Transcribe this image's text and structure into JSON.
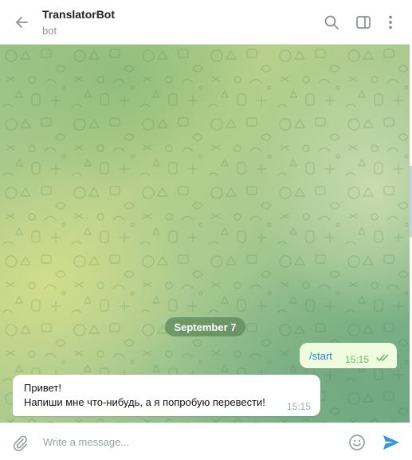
{
  "header": {
    "title": "TranslatorBot",
    "subtitle": "bot",
    "icons": [
      "back-arrow-icon",
      "search-icon",
      "sidebar-toggle-icon",
      "more-vertical-icon"
    ]
  },
  "chat": {
    "date_separator": "September 7",
    "outgoing": {
      "text": "/start",
      "time": "15:15",
      "status": "read"
    },
    "incoming": {
      "line1": "Привет!",
      "line2": "Напиши мне что-нибудь, а я попробую перевести!",
      "time": "15:15"
    }
  },
  "composer": {
    "placeholder": "Write a message...",
    "icons": [
      "paperclip-icon",
      "emoji-icon",
      "send-icon"
    ]
  },
  "colors": {
    "accent": "#2a7fd4",
    "outgoing_bubble": "#effdde",
    "read_ticks": "#5dbb62",
    "send_button": "#3a95e0"
  }
}
